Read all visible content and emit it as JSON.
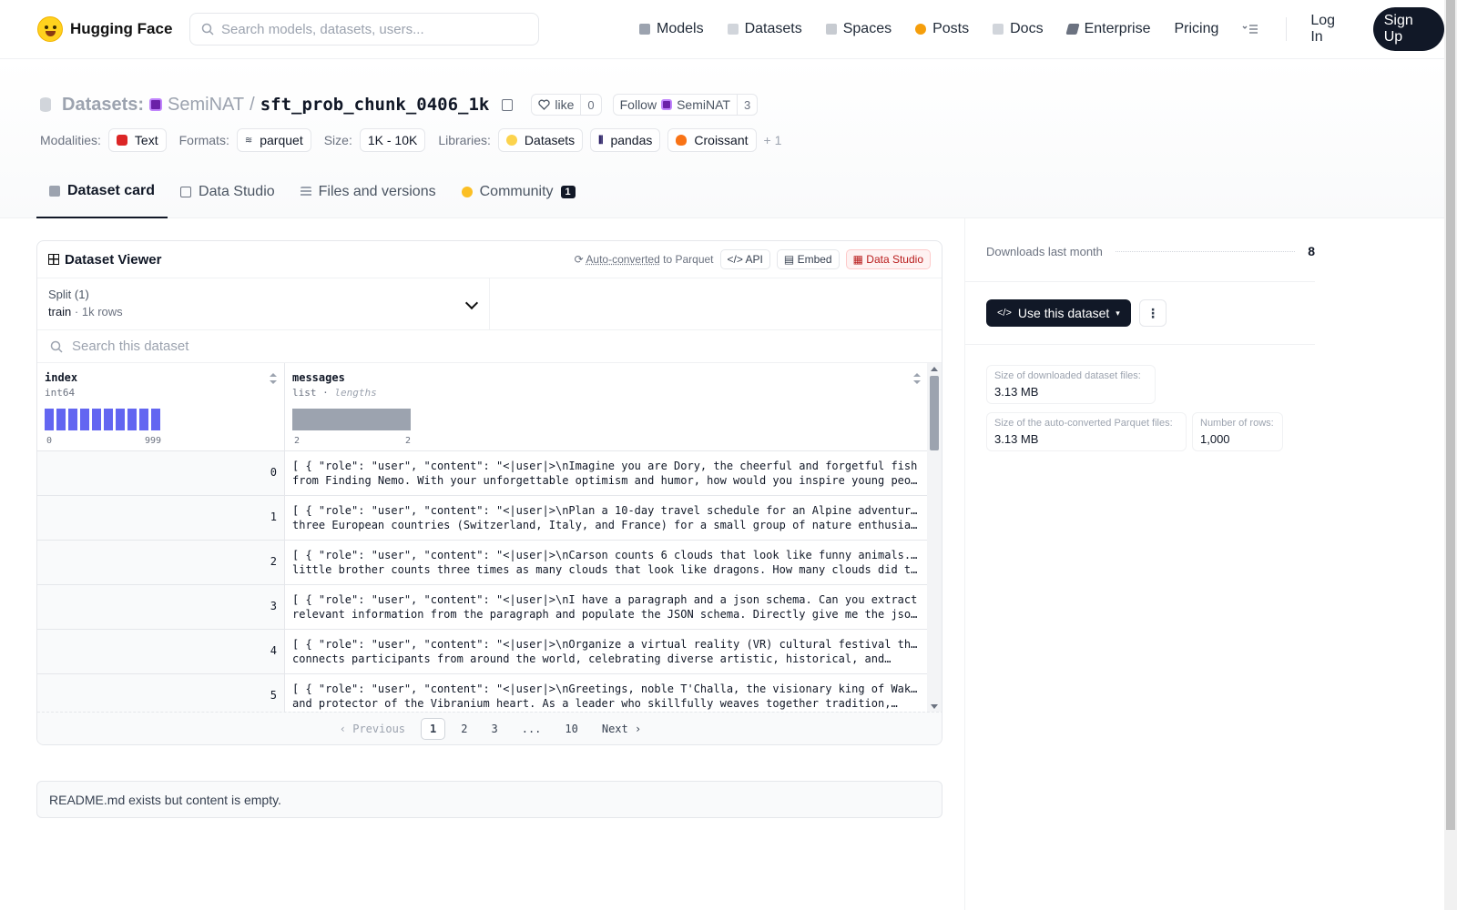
{
  "nav": {
    "brand": "Hugging Face",
    "search_placeholder": "Search models, datasets, users...",
    "links": [
      "Models",
      "Datasets",
      "Spaces",
      "Posts",
      "Docs",
      "Enterprise",
      "Pricing"
    ],
    "login": "Log In",
    "signup": "Sign Up"
  },
  "header": {
    "section": "Datasets:",
    "org": "SemiNAT",
    "slash": "/",
    "name": "sft_prob_chunk_0406_1k",
    "like_label": "like",
    "like_count": "0",
    "follow_label": "Follow",
    "follow_org": "SemiNAT",
    "follow_count": "3",
    "modalities_label": "Modalities:",
    "modality": "Text",
    "formats_label": "Formats:",
    "format": "parquet",
    "size_label": "Size:",
    "size": "1K - 10K",
    "libraries_label": "Libraries:",
    "libraries": [
      "Datasets",
      "pandas",
      "Croissant"
    ],
    "more_libraries": "+ 1"
  },
  "tabs": {
    "card": "Dataset card",
    "studio": "Data Studio",
    "files": "Files and versions",
    "community": "Community",
    "community_count": "1"
  },
  "viewer": {
    "title": "Dataset Viewer",
    "auto_converted": "Auto-converted",
    "to_parquet": "to Parquet",
    "api": "API",
    "embed": "Embed",
    "data_studio": "Data Studio",
    "split_label": "Split (1)",
    "split_value": "train",
    "split_rows": "1k rows",
    "search_placeholder": "Search this dataset",
    "columns": [
      {
        "name": "index",
        "type": "int64",
        "min": "0",
        "max": "999"
      },
      {
        "name": "messages",
        "type": "list",
        "type_note": "lengths",
        "min": "2",
        "max": "2"
      }
    ],
    "rows": [
      {
        "idx": "0",
        "line1": "[ { \"role\": \"user\", \"content\": \"<|user|>\\nImagine you are Dory, the cheerful and forgetful fish",
        "line2": "from Finding Nemo. With your unforgettable optimism and humor, how would you inspire young people…"
      },
      {
        "idx": "1",
        "line1": "[ { \"role\": \"user\", \"content\": \"<|user|>\\nPlan a 10-day travel schedule for an Alpine adventure in",
        "line2": "three European countries (Switzerland, Italy, and France) for a small group of nature enthusiasts…"
      },
      {
        "idx": "2",
        "line1": "[ { \"role\": \"user\", \"content\": \"<|user|>\\nCarson counts 6 clouds that look like funny animals. His",
        "line2": "little brother counts three times as many clouds that look like dragons. How many clouds did they…"
      },
      {
        "idx": "3",
        "line1": "[ { \"role\": \"user\", \"content\": \"<|user|>\\nI have a paragraph and a json schema. Can you extract",
        "line2": "relevant information from the paragraph and populate the JSON schema. Directly give me the json…"
      },
      {
        "idx": "4",
        "line1": "[ { \"role\": \"user\", \"content\": \"<|user|>\\nOrganize a virtual reality (VR) cultural festival that",
        "line2": "connects participants from around the world, celebrating diverse artistic, historical, and…"
      },
      {
        "idx": "5",
        "line1": "[ { \"role\": \"user\", \"content\": \"<|user|>\\nGreetings, noble T'Challa, the visionary king of Wakanda",
        "line2": "and protector of the Vibranium heart. As a leader who skillfully weaves together tradition,…"
      }
    ],
    "pager": {
      "prev": "Previous",
      "pages": [
        "1",
        "2",
        "3",
        "...",
        "10"
      ],
      "next": "Next",
      "current": "1"
    }
  },
  "readme": "README.md exists but content is empty.",
  "sidebar": {
    "downloads_label": "Downloads last month",
    "downloads_value": "8",
    "use_button": "Use this dataset",
    "stats": [
      {
        "k": "Size of downloaded dataset files:",
        "v": "3.13 MB"
      },
      {
        "k": "Size of the auto-converted Parquet files:",
        "v": "3.13 MB"
      },
      {
        "k": "Number of rows:",
        "v": "1,000"
      }
    ]
  },
  "colors": {
    "accent": "#111827",
    "hist": "#6366f1",
    "brand_yellow": "#ffd21e"
  }
}
